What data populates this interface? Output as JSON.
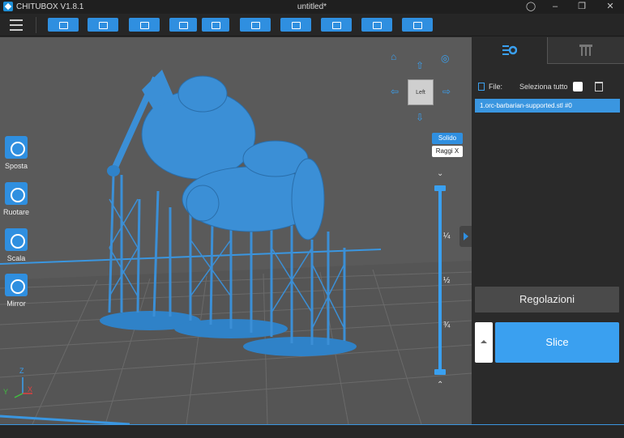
{
  "titlebar": {
    "app_name": "CHITUBOX V1.8.1",
    "document_title": "untitled*"
  },
  "left_tools": [
    {
      "label": "Sposta",
      "icon": "move-icon"
    },
    {
      "label": "Ruotare",
      "icon": "rotate-icon"
    },
    {
      "label": "Scala",
      "icon": "scale-icon"
    },
    {
      "label": "Mirror",
      "icon": "mirror-icon"
    }
  ],
  "view_cube": {
    "face_label": "Left"
  },
  "render_modes": {
    "solid": "Solido",
    "xray": "Raggi X"
  },
  "layer_slider": {
    "quarter": "¼",
    "half": "½",
    "three_quarter": "¾"
  },
  "right_panel": {
    "file_label": "File:",
    "select_all_label": "Seleziona tutto",
    "files": [
      "1.orc-barbarian-supported.stl #0"
    ],
    "adjust_button": "Regolazioni",
    "slice_button": "Slice"
  },
  "colors": {
    "accent": "#2f8fe0",
    "model": "#3b8fd6",
    "viewport": "#5a5a5a"
  },
  "axis_labels": {
    "z": "Z",
    "y": "Y",
    "x": "X"
  }
}
